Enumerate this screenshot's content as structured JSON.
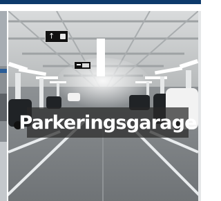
{
  "card": {
    "label": "Parkeringsgarage",
    "icons": {
      "arrow_sign": "arrow-up-icon",
      "parking_sign": "car-icon",
      "exit_sign": "exit-sign-icon"
    }
  },
  "colors": {
    "brand": "#0d3a6b",
    "banner": "#282828",
    "label_text": "#ffffff"
  }
}
